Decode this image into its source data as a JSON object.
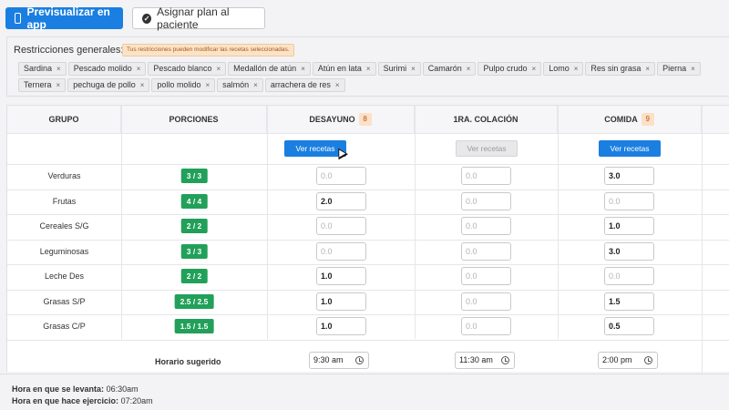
{
  "topbar": {
    "preview_label": "Previsualizar en app",
    "assign_label": "Asignar plan al paciente"
  },
  "restrictions": {
    "label": "Restricciones generales:",
    "warning": "Tus restricciones pueden modificar las recetas seleccionadas.",
    "chips": [
      "Sardina",
      "Pescado molido",
      "Pescado blanco",
      "Medallón de atún",
      "Atún en lata",
      "Surimi",
      "Camarón",
      "Pulpo crudo",
      "Lomo",
      "Res sin grasa",
      "Pierna",
      "Ternera",
      "pechuga de pollo",
      "pollo molido",
      "salmón",
      "arrachera de res"
    ],
    "remove_symbol": "×"
  },
  "table": {
    "headers": {
      "grupo": "GRUPO",
      "porciones": "PORCIONES",
      "desayuno": "DESAYUNO",
      "desayuno_badge": "8",
      "colacion": "1RA. COLACIÓN",
      "comida": "COMIDA",
      "comida_badge": "9"
    },
    "ver_recetas": "Ver recetas",
    "rows": [
      {
        "grupo": "Verduras",
        "porcion": "3 / 3",
        "desayuno": "0.0",
        "colacion": "0.0",
        "comida": "3.0"
      },
      {
        "grupo": "Frutas",
        "porcion": "4 / 4",
        "desayuno": "2.0",
        "colacion": "0.0",
        "comida": "0.0"
      },
      {
        "grupo": "Cereales S/G",
        "porcion": "2 / 2",
        "desayuno": "0.0",
        "colacion": "0.0",
        "comida": "1.0"
      },
      {
        "grupo": "Leguminosas",
        "porcion": "3 / 3",
        "desayuno": "0.0",
        "colacion": "0.0",
        "comida": "3.0"
      },
      {
        "grupo": "Leche Des",
        "porcion": "2 / 2",
        "desayuno": "1.0",
        "colacion": "0.0",
        "comida": "0.0"
      },
      {
        "grupo": "Grasas S/P",
        "porcion": "2.5 / 2.5",
        "desayuno": "1.0",
        "colacion": "0.0",
        "comida": "1.5"
      },
      {
        "grupo": "Grasas C/P",
        "porcion": "1.5 / 1.5",
        "desayuno": "1.0",
        "colacion": "0.0",
        "comida": "0.5"
      }
    ],
    "horario_label": "Horario sugerido",
    "horarios": {
      "desayuno": "9:30 am",
      "colacion": "11:30 am",
      "comida": "2:00 pm"
    }
  },
  "footer": {
    "levanta_label": "Hora en que se levanta:",
    "levanta_value": "06:30am",
    "ejercicio_label": "Hora en que hace ejercicio:",
    "ejercicio_value": "07:20am"
  },
  "colors": {
    "primary": "#1a7fe0",
    "success": "#22a05a",
    "badge": "#fde0c6"
  }
}
